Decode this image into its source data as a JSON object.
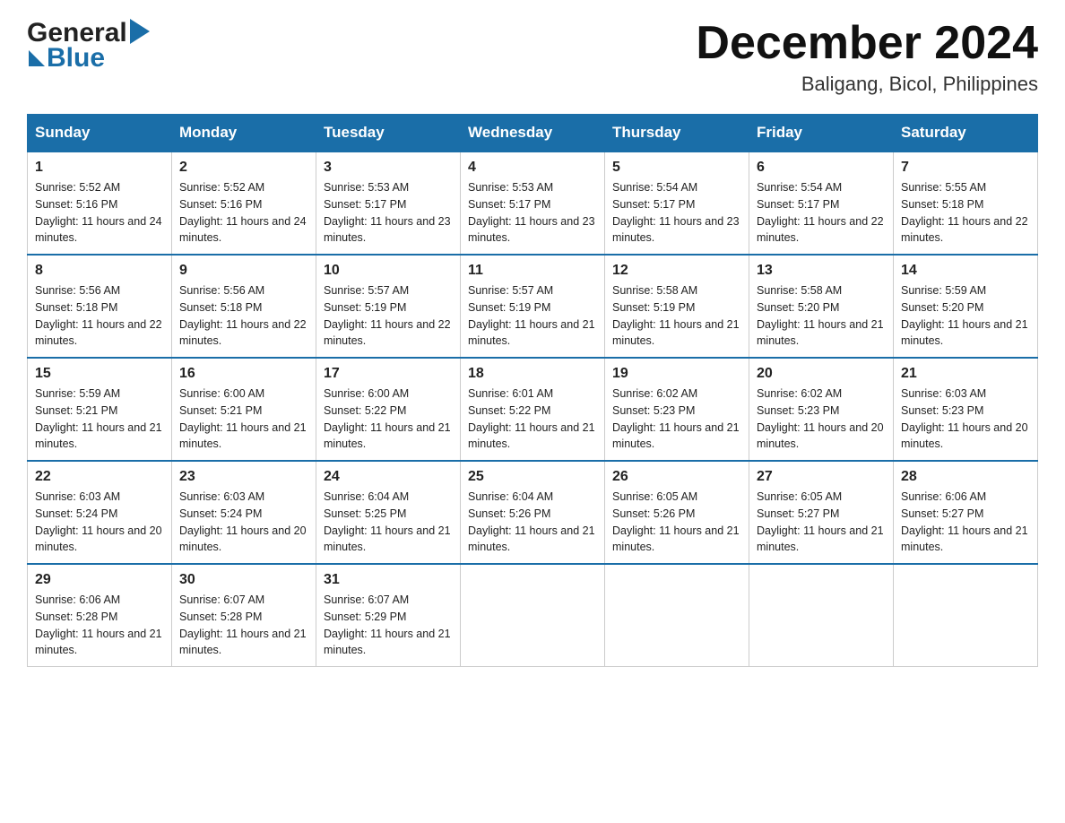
{
  "logo": {
    "general": "General",
    "blue": "Blue",
    "tagline": "Blue"
  },
  "header": {
    "month": "December 2024",
    "location": "Baligang, Bicol, Philippines"
  },
  "days_of_week": [
    "Sunday",
    "Monday",
    "Tuesday",
    "Wednesday",
    "Thursday",
    "Friday",
    "Saturday"
  ],
  "weeks": [
    [
      {
        "day": "1",
        "sunrise": "Sunrise: 5:52 AM",
        "sunset": "Sunset: 5:16 PM",
        "daylight": "Daylight: 11 hours and 24 minutes."
      },
      {
        "day": "2",
        "sunrise": "Sunrise: 5:52 AM",
        "sunset": "Sunset: 5:16 PM",
        "daylight": "Daylight: 11 hours and 24 minutes."
      },
      {
        "day": "3",
        "sunrise": "Sunrise: 5:53 AM",
        "sunset": "Sunset: 5:17 PM",
        "daylight": "Daylight: 11 hours and 23 minutes."
      },
      {
        "day": "4",
        "sunrise": "Sunrise: 5:53 AM",
        "sunset": "Sunset: 5:17 PM",
        "daylight": "Daylight: 11 hours and 23 minutes."
      },
      {
        "day": "5",
        "sunrise": "Sunrise: 5:54 AM",
        "sunset": "Sunset: 5:17 PM",
        "daylight": "Daylight: 11 hours and 23 minutes."
      },
      {
        "day": "6",
        "sunrise": "Sunrise: 5:54 AM",
        "sunset": "Sunset: 5:17 PM",
        "daylight": "Daylight: 11 hours and 22 minutes."
      },
      {
        "day": "7",
        "sunrise": "Sunrise: 5:55 AM",
        "sunset": "Sunset: 5:18 PM",
        "daylight": "Daylight: 11 hours and 22 minutes."
      }
    ],
    [
      {
        "day": "8",
        "sunrise": "Sunrise: 5:56 AM",
        "sunset": "Sunset: 5:18 PM",
        "daylight": "Daylight: 11 hours and 22 minutes."
      },
      {
        "day": "9",
        "sunrise": "Sunrise: 5:56 AM",
        "sunset": "Sunset: 5:18 PM",
        "daylight": "Daylight: 11 hours and 22 minutes."
      },
      {
        "day": "10",
        "sunrise": "Sunrise: 5:57 AM",
        "sunset": "Sunset: 5:19 PM",
        "daylight": "Daylight: 11 hours and 22 minutes."
      },
      {
        "day": "11",
        "sunrise": "Sunrise: 5:57 AM",
        "sunset": "Sunset: 5:19 PM",
        "daylight": "Daylight: 11 hours and 21 minutes."
      },
      {
        "day": "12",
        "sunrise": "Sunrise: 5:58 AM",
        "sunset": "Sunset: 5:19 PM",
        "daylight": "Daylight: 11 hours and 21 minutes."
      },
      {
        "day": "13",
        "sunrise": "Sunrise: 5:58 AM",
        "sunset": "Sunset: 5:20 PM",
        "daylight": "Daylight: 11 hours and 21 minutes."
      },
      {
        "day": "14",
        "sunrise": "Sunrise: 5:59 AM",
        "sunset": "Sunset: 5:20 PM",
        "daylight": "Daylight: 11 hours and 21 minutes."
      }
    ],
    [
      {
        "day": "15",
        "sunrise": "Sunrise: 5:59 AM",
        "sunset": "Sunset: 5:21 PM",
        "daylight": "Daylight: 11 hours and 21 minutes."
      },
      {
        "day": "16",
        "sunrise": "Sunrise: 6:00 AM",
        "sunset": "Sunset: 5:21 PM",
        "daylight": "Daylight: 11 hours and 21 minutes."
      },
      {
        "day": "17",
        "sunrise": "Sunrise: 6:00 AM",
        "sunset": "Sunset: 5:22 PM",
        "daylight": "Daylight: 11 hours and 21 minutes."
      },
      {
        "day": "18",
        "sunrise": "Sunrise: 6:01 AM",
        "sunset": "Sunset: 5:22 PM",
        "daylight": "Daylight: 11 hours and 21 minutes."
      },
      {
        "day": "19",
        "sunrise": "Sunrise: 6:02 AM",
        "sunset": "Sunset: 5:23 PM",
        "daylight": "Daylight: 11 hours and 21 minutes."
      },
      {
        "day": "20",
        "sunrise": "Sunrise: 6:02 AM",
        "sunset": "Sunset: 5:23 PM",
        "daylight": "Daylight: 11 hours and 20 minutes."
      },
      {
        "day": "21",
        "sunrise": "Sunrise: 6:03 AM",
        "sunset": "Sunset: 5:23 PM",
        "daylight": "Daylight: 11 hours and 20 minutes."
      }
    ],
    [
      {
        "day": "22",
        "sunrise": "Sunrise: 6:03 AM",
        "sunset": "Sunset: 5:24 PM",
        "daylight": "Daylight: 11 hours and 20 minutes."
      },
      {
        "day": "23",
        "sunrise": "Sunrise: 6:03 AM",
        "sunset": "Sunset: 5:24 PM",
        "daylight": "Daylight: 11 hours and 20 minutes."
      },
      {
        "day": "24",
        "sunrise": "Sunrise: 6:04 AM",
        "sunset": "Sunset: 5:25 PM",
        "daylight": "Daylight: 11 hours and 21 minutes."
      },
      {
        "day": "25",
        "sunrise": "Sunrise: 6:04 AM",
        "sunset": "Sunset: 5:26 PM",
        "daylight": "Daylight: 11 hours and 21 minutes."
      },
      {
        "day": "26",
        "sunrise": "Sunrise: 6:05 AM",
        "sunset": "Sunset: 5:26 PM",
        "daylight": "Daylight: 11 hours and 21 minutes."
      },
      {
        "day": "27",
        "sunrise": "Sunrise: 6:05 AM",
        "sunset": "Sunset: 5:27 PM",
        "daylight": "Daylight: 11 hours and 21 minutes."
      },
      {
        "day": "28",
        "sunrise": "Sunrise: 6:06 AM",
        "sunset": "Sunset: 5:27 PM",
        "daylight": "Daylight: 11 hours and 21 minutes."
      }
    ],
    [
      {
        "day": "29",
        "sunrise": "Sunrise: 6:06 AM",
        "sunset": "Sunset: 5:28 PM",
        "daylight": "Daylight: 11 hours and 21 minutes."
      },
      {
        "day": "30",
        "sunrise": "Sunrise: 6:07 AM",
        "sunset": "Sunset: 5:28 PM",
        "daylight": "Daylight: 11 hours and 21 minutes."
      },
      {
        "day": "31",
        "sunrise": "Sunrise: 6:07 AM",
        "sunset": "Sunset: 5:29 PM",
        "daylight": "Daylight: 11 hours and 21 minutes."
      },
      null,
      null,
      null,
      null
    ]
  ]
}
